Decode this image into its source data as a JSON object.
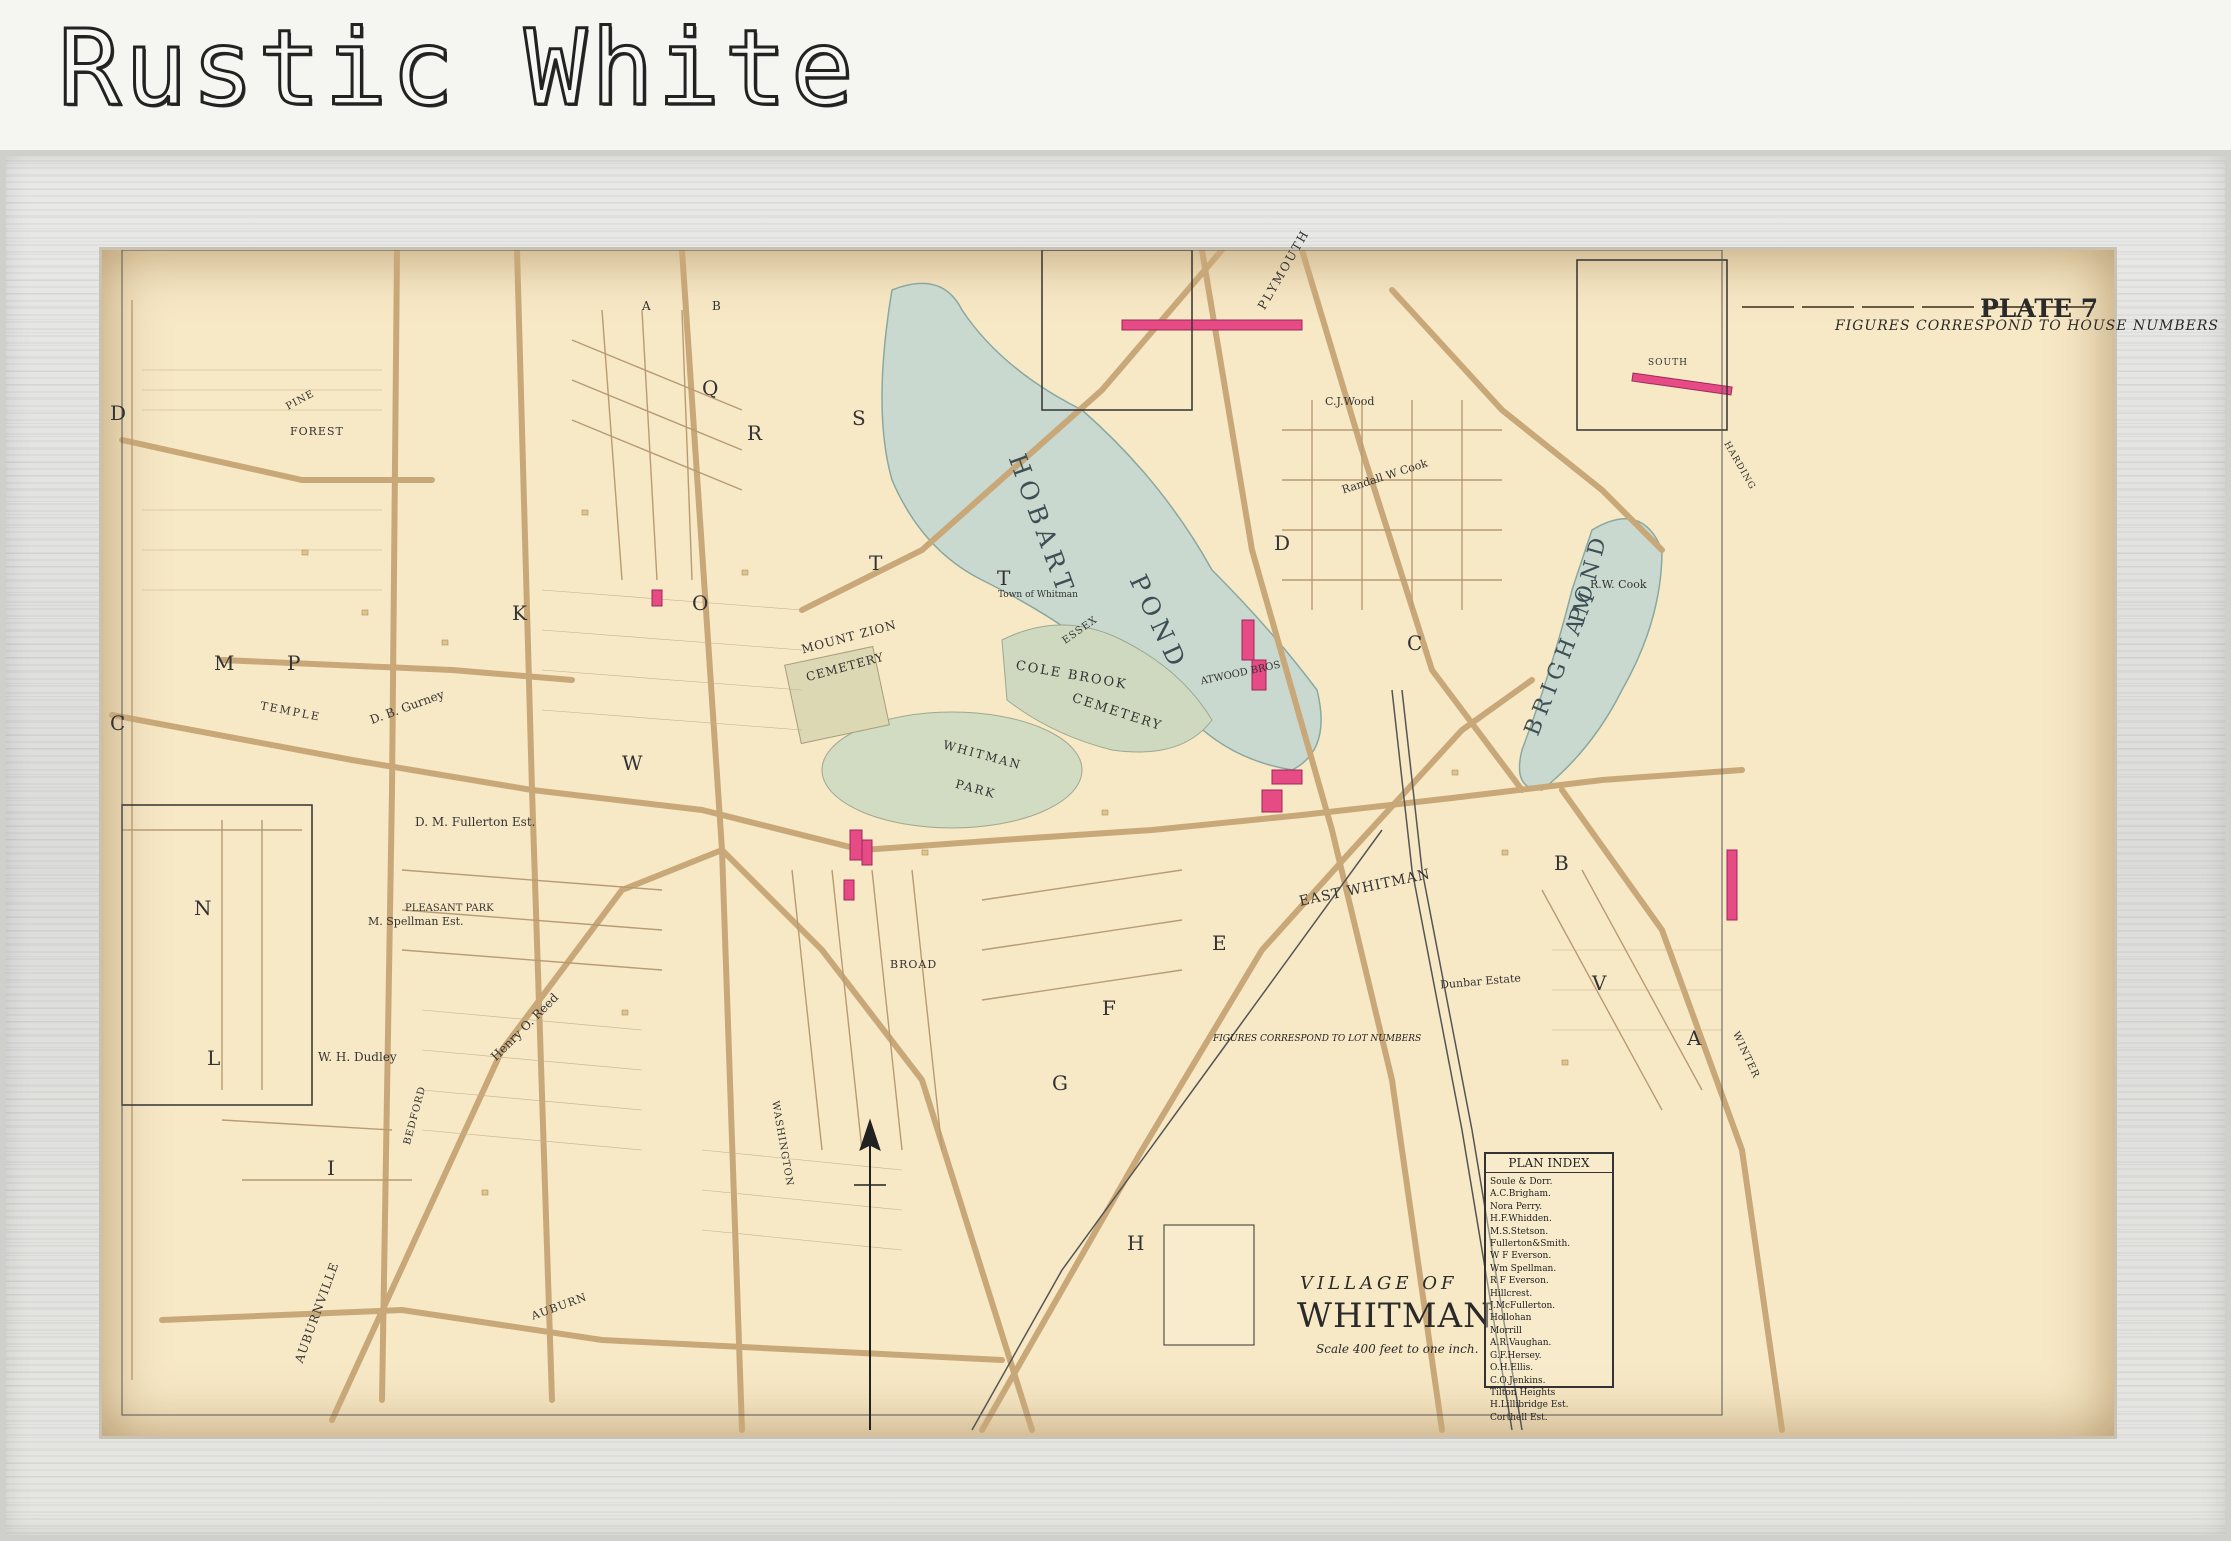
{
  "header": {
    "title": "Rustic White"
  },
  "map": {
    "plate": "PLATE 7",
    "figures_heading": "FIGURES CORRESPOND TO HOUSE NUMBERS",
    "lot_heading": "FIGURES CORRESPOND TO LOT NUMBERS",
    "village_label": "VILLAGE OF",
    "town_name": "WHITMAN",
    "scale": "Scale 400 feet to one inch.",
    "labels": {
      "hobart": "HOBART",
      "pond": "POND",
      "brigham": "BRIGHAM",
      "brigham_pond": "POND",
      "cole_brook": "COLE BROOK",
      "cemetery": "CEMETERY",
      "whitman_park": "WHITMAN",
      "park": "PARK",
      "mount_zion": "MOUNT ZION",
      "mount_zion_cemetery": "CEMETERY",
      "east_whitman": "EAST WHITMAN",
      "auburnville": "AUBURNVILLE",
      "temple_st": "TEMPLE",
      "plymouth": "PLYMOUTH",
      "dunbar_est": "Dunbar Estate",
      "pleasant_park": "PLEASANT PARK",
      "broad": "BROAD",
      "auburn": "AUBURN",
      "forest": "FOREST",
      "pine": "PINE",
      "essex": "ESSEX",
      "d_b_gurney": "D. B. Gurney",
      "w_h_dudley": "W. H. Dudley",
      "henry_reed": "Henry O. Reed",
      "dm_fullerton": "D. M. Fullerton Est.",
      "spellman": "M. Spellman Est.",
      "rw_cook": "R.W. Cook",
      "randall_cook": "Randall W Cook",
      "cj_wood": "C.J.Wood",
      "atwood": "ATWOOD BROS",
      "town_of_whitman": "Town of Whitman",
      "bedford": "BEDFORD",
      "winter": "WINTER",
      "south": "SOUTH",
      "washington": "WASHINGTON",
      "harding": "HARDING"
    },
    "plan_index": {
      "title": "PLAN INDEX",
      "items": [
        "Soule & Dorr.",
        "A.C.Brigham.",
        "Nora Perry.",
        "H.F.Whidden.",
        "M.S.Stetson.",
        "Fullerton&Smith.",
        "W F Everson.",
        "Wm Spellman.",
        "R F Everson.",
        "Hillcrest.",
        "J.McFullerton.",
        "Hollohan",
        "Morrill",
        "A.R.Vaughan.",
        "G.F.Hersey.",
        "O.H.Ellis.",
        "C.O.Jenkins.",
        "Tilton Heights",
        "H.Lillibridge Est.",
        "Corthell Est."
      ]
    },
    "colors": {
      "paper": "#f7e8c6",
      "water": "#c9d9cf",
      "road": "#c8a878",
      "building_pink": "#e64b86",
      "ink": "#2d2d2d"
    },
    "letter_markers": [
      "A",
      "B",
      "C",
      "D",
      "E",
      "F",
      "G",
      "H",
      "I",
      "K",
      "L",
      "M",
      "N",
      "O",
      "P",
      "Q",
      "R",
      "S",
      "T",
      "V",
      "W"
    ]
  }
}
